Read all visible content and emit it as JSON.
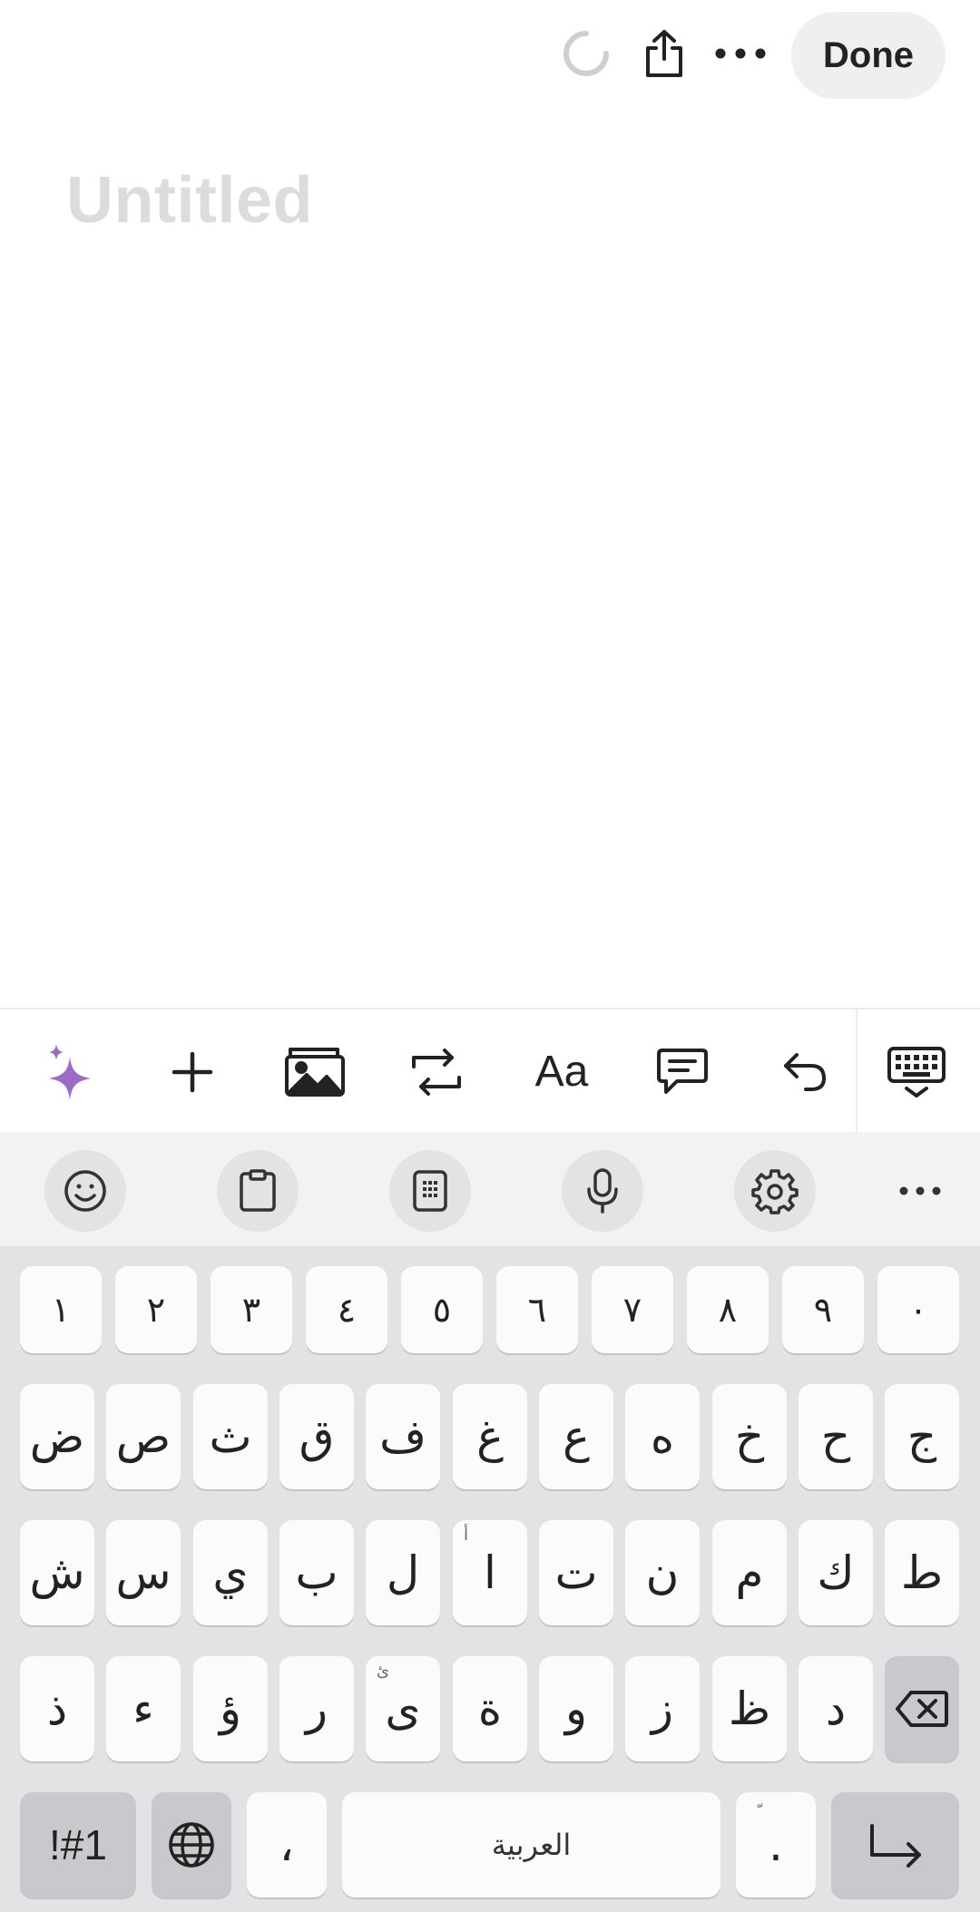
{
  "toolbar": {
    "done_label": "Done",
    "icons": [
      "loading-spinner",
      "share-icon",
      "more-icon"
    ]
  },
  "note": {
    "title_placeholder": "Untitled"
  },
  "format_bar": {
    "items": [
      "ai-sparkle-icon",
      "add-icon",
      "image-icon",
      "convert-icon",
      "text-format",
      "comment-icon",
      "undo-icon",
      "keyboard-hide-icon"
    ],
    "text_format_label": "Aa",
    "accent_color": "#9b6bc6"
  },
  "keyboard": {
    "tools": [
      "emoji-icon",
      "clipboard-icon",
      "keypad-icon",
      "mic-icon",
      "settings-icon",
      "more-icon"
    ],
    "number_row": [
      "١",
      "٢",
      "٣",
      "٤",
      "٥",
      "٦",
      "٧",
      "٨",
      "٩",
      "٠"
    ],
    "row1": [
      "ض",
      "ص",
      "ث",
      "ق",
      "ف",
      "غ",
      "ع",
      "ه",
      "خ",
      "ح",
      "ج"
    ],
    "row2": [
      "ش",
      "س",
      "ي",
      "ب",
      "ل",
      "ا",
      "ت",
      "ن",
      "م",
      "ك",
      "ط"
    ],
    "row2_hint": "أ",
    "row3": [
      "ذ",
      "ء",
      "ؤ",
      "ر",
      "ى",
      "ة",
      "و",
      "ز",
      "ظ",
      "د"
    ],
    "row3_hint": "ئ",
    "symbols_label": "!#1",
    "comma": "،",
    "space_label": "العربية",
    "period": ".",
    "period_hint": "ّ"
  }
}
